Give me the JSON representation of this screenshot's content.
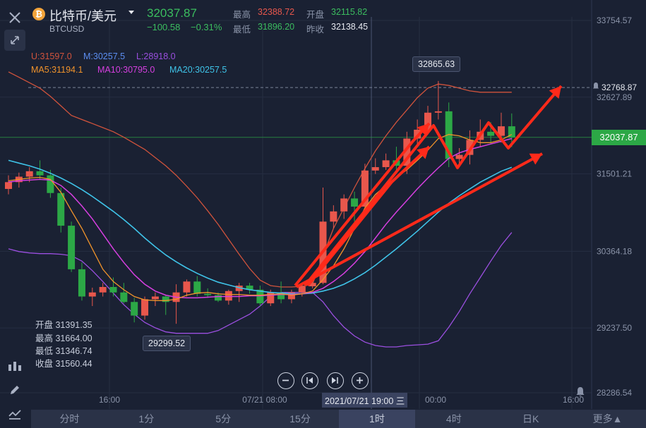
{
  "header": {
    "title": "比特币/美元",
    "symbol": "BTCUSD",
    "price": "32037.87",
    "change": "−100.58",
    "change_pct": "−0.31%",
    "high_label": "最高",
    "high": "32388.72",
    "low_label": "最低",
    "low": "31896.20",
    "open_label": "开盘",
    "open": "32115.82",
    "prev_label": "昨收",
    "prev_close": "32138.45"
  },
  "indicators": {
    "boll": [
      "U:31597.0",
      "M:30257.5",
      "L:28918.0"
    ],
    "ma": [
      "MA5:31194.1",
      "MA10:30795.0",
      "MA20:30257.5"
    ]
  },
  "ohlc_panel": {
    "open": "开盘 31391.35",
    "high": "最高 31664.00",
    "low": "最低 31346.74",
    "close": "收盘 31560.44"
  },
  "callouts": {
    "max": "32865.63",
    "min": "29299.52",
    "alert": "32768.87",
    "last": "32037.87",
    "crosshair_time": "2021/07/21 19:00 三"
  },
  "tabs": [
    "分时",
    "1分",
    "5分",
    "15分",
    "1时",
    "4时",
    "日K",
    "更多▲"
  ],
  "colors": {
    "up": "#e8574c",
    "down": "#2ca846",
    "ma5": "#f0932b",
    "ma10": "#d63fe0",
    "ma20": "#3fc3e8",
    "boll_u": "#d0533c",
    "boll_l": "#9b4fe0",
    "accent": "#2ca846"
  },
  "chart_data": {
    "type": "candlestick",
    "y_ticks": [
      "33754.57",
      "32627.89",
      "31501.21",
      "30364.18",
      "29237.50",
      "28286.54"
    ],
    "x_ticks": [
      "16:00",
      "07/21 08:00",
      "00:00",
      "16:00"
    ],
    "candles": [
      [
        31280,
        31480,
        31200,
        31380
      ],
      [
        31380,
        31520,
        31300,
        31460
      ],
      [
        31460,
        31600,
        31380,
        31540
      ],
      [
        31540,
        31700,
        31420,
        31480
      ],
      [
        31480,
        31560,
        31150,
        31220
      ],
      [
        31220,
        31300,
        30640,
        30740
      ],
      [
        30740,
        30800,
        30060,
        30100
      ],
      [
        30100,
        30200,
        29640,
        29700
      ],
      [
        29700,
        29830,
        29560,
        29760
      ],
      [
        29760,
        29900,
        29700,
        29840
      ],
      [
        29840,
        29980,
        29700,
        29760
      ],
      [
        29760,
        29900,
        29600,
        29620
      ],
      [
        29620,
        29680,
        29320,
        29420
      ],
      [
        29420,
        29700,
        29360,
        29660
      ],
      [
        29660,
        29760,
        29560,
        29700
      ],
      [
        29700,
        29720,
        29430,
        29620
      ],
      [
        29620,
        29880,
        29299.52,
        29760
      ],
      [
        29760,
        29950,
        29700,
        29920
      ],
      [
        29920,
        30000,
        29700,
        29740
      ],
      [
        29740,
        29820,
        29680,
        29720
      ],
      [
        29720,
        29760,
        29620,
        29640
      ],
      [
        29640,
        29800,
        29580,
        29780
      ],
      [
        29780,
        29900,
        29620,
        29860
      ],
      [
        29860,
        29900,
        29740,
        29800
      ],
      [
        29800,
        29860,
        29560,
        29600
      ],
      [
        29600,
        29800,
        29560,
        29760
      ],
      [
        29760,
        29920,
        29600,
        29660
      ],
      [
        29660,
        29800,
        29600,
        29760
      ],
      [
        29760,
        29880,
        29700,
        29850
      ],
      [
        29850,
        30020,
        29820,
        29900
      ],
      [
        29900,
        31300,
        29880,
        30800
      ],
      [
        30800,
        31040,
        30700,
        30950
      ],
      [
        30950,
        31200,
        30840,
        31140
      ],
      [
        31140,
        31240,
        30800,
        31020
      ],
      [
        31020,
        31650,
        30980,
        31550
      ],
      [
        31550,
        31730,
        31500,
        31600
      ],
      [
        31600,
        31800,
        31560,
        31700
      ],
      [
        31700,
        31900,
        31560,
        31620
      ],
      [
        31620,
        32120,
        31500,
        32020
      ],
      [
        32020,
        32300,
        31900,
        32150
      ],
      [
        32150,
        32500,
        32080,
        32400
      ],
      [
        32400,
        32865.63,
        32300,
        32420
      ],
      [
        32420,
        32550,
        31600,
        31720
      ],
      [
        31720,
        31880,
        31600,
        31780
      ],
      [
        31780,
        32140,
        31640,
        32000
      ],
      [
        32000,
        32300,
        31900,
        32120
      ],
      [
        32120,
        32260,
        31950,
        32060
      ],
      [
        32060,
        32400,
        31960,
        32200
      ],
      [
        32200,
        32388.72,
        31896.2,
        32037.87
      ]
    ],
    "ma5": [
      31400,
      31420,
      31440,
      31450,
      31420,
      31230,
      30960,
      30700,
      30400,
      30100,
      29920,
      29800,
      29700,
      29650,
      29640,
      29640,
      29660,
      29720,
      29750,
      29760,
      29740,
      29730,
      29730,
      29720,
      29720,
      29730,
      29740,
      29720,
      29740,
      29780,
      29950,
      30150,
      30400,
      30700,
      31000,
      31200,
      31330,
      31450,
      31560,
      31700,
      31850,
      32020,
      32080,
      32060,
      32000,
      31960,
      31960,
      32000,
      32080
    ],
    "ma10": [
      31380,
      31400,
      31410,
      31420,
      31410,
      31330,
      31200,
      31030,
      30840,
      30620,
      30400,
      30200,
      30020,
      29880,
      29780,
      29720,
      29690,
      29680,
      29680,
      29690,
      29700,
      29700,
      29700,
      29710,
      29710,
      29720,
      29730,
      29730,
      29740,
      29760,
      29820,
      29920,
      30040,
      30190,
      30360,
      30560,
      30760,
      30940,
      31110,
      31280,
      31440,
      31590,
      31730,
      31810,
      31860,
      31900,
      31940,
      31980,
      32020
    ],
    "ma20": [
      31700,
      31660,
      31620,
      31570,
      31510,
      31440,
      31360,
      31270,
      31170,
      31060,
      30950,
      30830,
      30700,
      30560,
      30430,
      30310,
      30210,
      30120,
      30040,
      29970,
      29910,
      29870,
      29830,
      29800,
      29780,
      29760,
      29750,
      29740,
      29740,
      29750,
      29780,
      29820,
      29880,
      29960,
      30050,
      30160,
      30280,
      30400,
      30530,
      30660,
      30800,
      30940,
      31070,
      31180,
      31280,
      31380,
      31460,
      31540,
      31597
    ],
    "boll_upper": [
      33000,
      32920,
      32840,
      32760,
      32640,
      32500,
      32360,
      32300,
      32240,
      32180,
      32120,
      32040,
      31950,
      31860,
      31740,
      31620,
      31480,
      31320,
      31150,
      30960,
      30760,
      30540,
      30320,
      30110,
      29940,
      29860,
      29840,
      29840,
      29850,
      29880,
      30300,
      30700,
      31000,
      31300,
      31580,
      31840,
      32060,
      32260,
      32440,
      32620,
      32760,
      32820,
      32800,
      32760,
      32720,
      32700,
      32700,
      32700,
      32700
    ],
    "boll_lower": [
      30400,
      30360,
      30340,
      30330,
      30330,
      30320,
      30300,
      30220,
      30080,
      29920,
      29750,
      29580,
      29440,
      29320,
      29240,
      29180,
      29160,
      29160,
      29160,
      29160,
      29200,
      29280,
      29360,
      29440,
      29560,
      29700,
      29760,
      29760,
      29760,
      29760,
      29620,
      29420,
      29250,
      29120,
      29030,
      28980,
      28960,
      28960,
      28980,
      28990,
      29000,
      29050,
      29250,
      29480,
      29740,
      29980,
      30220,
      30450,
      30640
    ],
    "ylim": [
      28286.54,
      33754.57
    ]
  }
}
